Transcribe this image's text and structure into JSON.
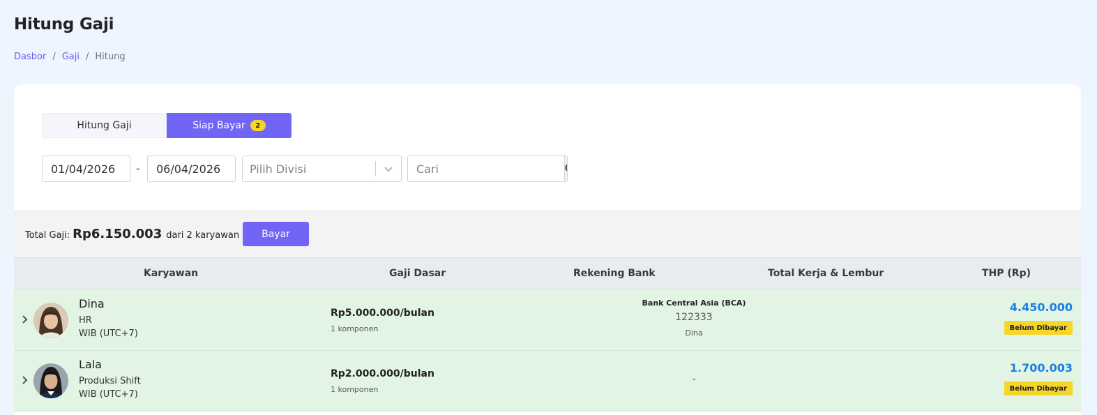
{
  "page": {
    "title": "Hitung Gaji"
  },
  "breadcrumb": {
    "items": [
      "Dasbor",
      "Gaji",
      "Hitung"
    ],
    "separator": "/"
  },
  "tabs": [
    {
      "label": "Hitung Gaji",
      "active": false
    },
    {
      "label": "Siap Bayar",
      "active": true,
      "badge": "2"
    }
  ],
  "filters": {
    "date_from": "01/04/2026",
    "date_separator": "-",
    "date_to": "06/04/2026",
    "division_placeholder": "Pilih Divisi",
    "search_placeholder": "Cari"
  },
  "summary": {
    "prefix": "Total Gaji:",
    "amount": "Rp6.150.003",
    "suffix": "dari 2 karyawan",
    "pay_button": "Bayar"
  },
  "table": {
    "headers": [
      "Karyawan",
      "Gaji Dasar",
      "Rekening Bank",
      "Total Kerja & Lembur",
      "THP (Rp)"
    ],
    "rows": [
      {
        "name": "Dina",
        "division": "HR",
        "timezone": "WIB (UTC+7)",
        "salary": "Rp5.000.000/bulan",
        "components": "1 komponen",
        "bank_name": "Bank Central Asia (BCA)",
        "bank_account": "122333",
        "bank_holder": "Dina",
        "work_overtime": "",
        "thp": "4.450.000",
        "status": "Belum Dibayar"
      },
      {
        "name": "Lala",
        "division": "Produksi Shift",
        "timezone": "WIB (UTC+7)",
        "salary": "Rp2.000.000/bulan",
        "components": "1 komponen",
        "bank_empty": "-",
        "work_overtime": "",
        "thp": "1.700.003",
        "status": "Belum Dibayar"
      }
    ]
  },
  "colors": {
    "accent": "#7065f4",
    "badge": "#f7d62a",
    "row_bg": "#e2f4e4",
    "thp": "#1f7fe0",
    "page_bg": "#eef5ff"
  },
  "icons": [
    "chevron-down-icon",
    "search-icon",
    "chevron-right-icon",
    "avatar"
  ]
}
